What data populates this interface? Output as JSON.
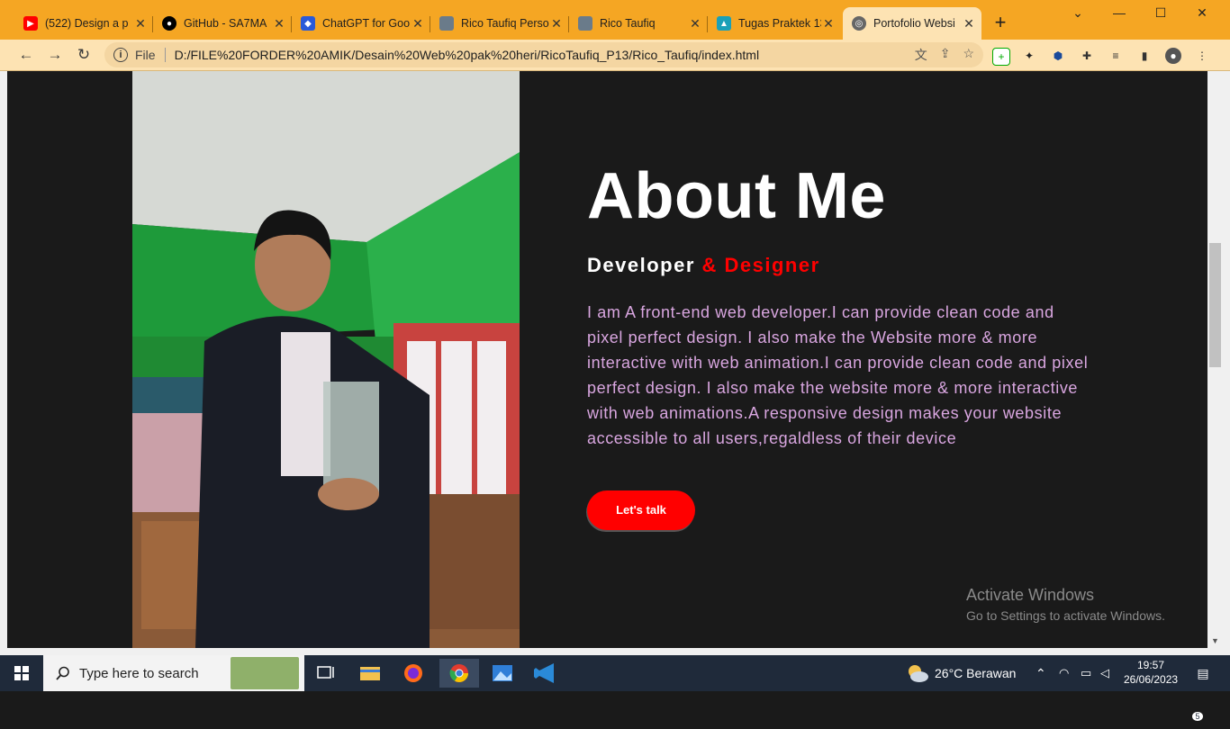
{
  "tabs": [
    {
      "label": "(522) Design a p",
      "icon": "youtube-icon",
      "color": "#ff0000"
    },
    {
      "label": "GitHub - SA7MA",
      "icon": "github-icon",
      "color": "#000000"
    },
    {
      "label": "ChatGPT for Goo",
      "icon": "chatgpt-ext-icon",
      "color": "#2a5ad8"
    },
    {
      "label": "Rico Taufiq Perso",
      "icon": "profile-photo-icon",
      "color": "#6a7b8a"
    },
    {
      "label": "Rico Taufiq",
      "icon": "profile-photo-icon",
      "color": "#6a7b8a"
    },
    {
      "label": "Tugas Praktek 13",
      "icon": "classroom-icon",
      "color": "#1aa0b8"
    },
    {
      "label": "Portofolio Websi",
      "icon": "globe-icon",
      "color": "#666666"
    }
  ],
  "omnibox": {
    "scheme_label": "File",
    "url": "D:/FILE%20FORDER%20AMIK/Desain%20Web%20pak%20heri/RicoTaufiq_P13/Rico_Taufiq/index.html"
  },
  "hero": {
    "title": "About Me",
    "subtitle_main": "Developer",
    "subtitle_accent": "& Designer",
    "paragraph": "I am A front-end web developer.I can provide clean code and pixel perfect design. I also make the Website more & more interactive with web animation.I can provide clean code and pixel perfect design. I also make the website more & more interactive with web animations.A responsive design makes your website accessible to all users,regaldless of their device",
    "cta_label": "Let's talk"
  },
  "watermark": {
    "line1": "Activate Windows",
    "line2": "Go to Settings to activate Windows."
  },
  "taskbar": {
    "search_placeholder": "Type here to search",
    "weather": "26°C  Berawan",
    "time": "19:57",
    "date": "26/06/2023",
    "notifications": "5"
  },
  "colors": {
    "accent": "#ff0000",
    "tabstrip": "#f5a623",
    "toolbar": "#fde3b3",
    "paragraph": "#d9a6e0",
    "page_bg": "#1a1a1a"
  }
}
